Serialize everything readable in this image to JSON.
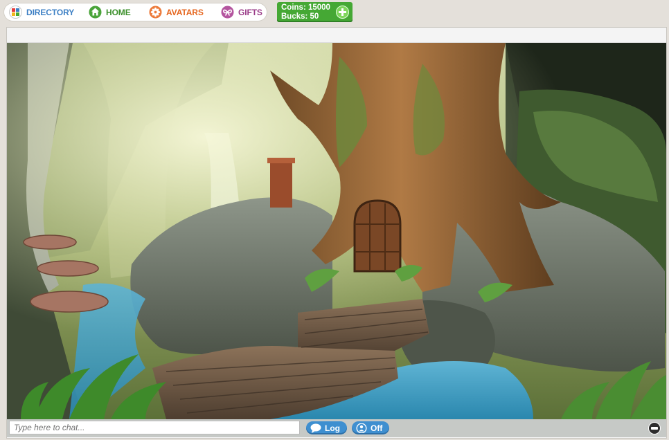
{
  "nav": {
    "directory": "DIRECTORY",
    "home": "HOME",
    "avatars": "AVATARS",
    "gifts": "GIFTS"
  },
  "currency": {
    "coins": "Coins: 15000",
    "bucks": "Bucks: 50"
  },
  "chat": {
    "placeholder": "Type here to chat...",
    "log_label": "Log",
    "off_label": "Off"
  },
  "colors": {
    "directory": "#3c7fc4",
    "home": "#3b8f2a",
    "avatars": "#e5661f",
    "gifts": "#9a3b88",
    "currency_bg": "#45a834",
    "chat_button": "#3e8fd0"
  },
  "icons": {
    "directory": "grid-icon",
    "home": "house-icon",
    "avatars": "flower-icon",
    "gifts": "bow-icon",
    "add": "plus-icon",
    "log": "speech-bubble-icon",
    "off": "person-icon",
    "minimize": "minus-icon"
  }
}
